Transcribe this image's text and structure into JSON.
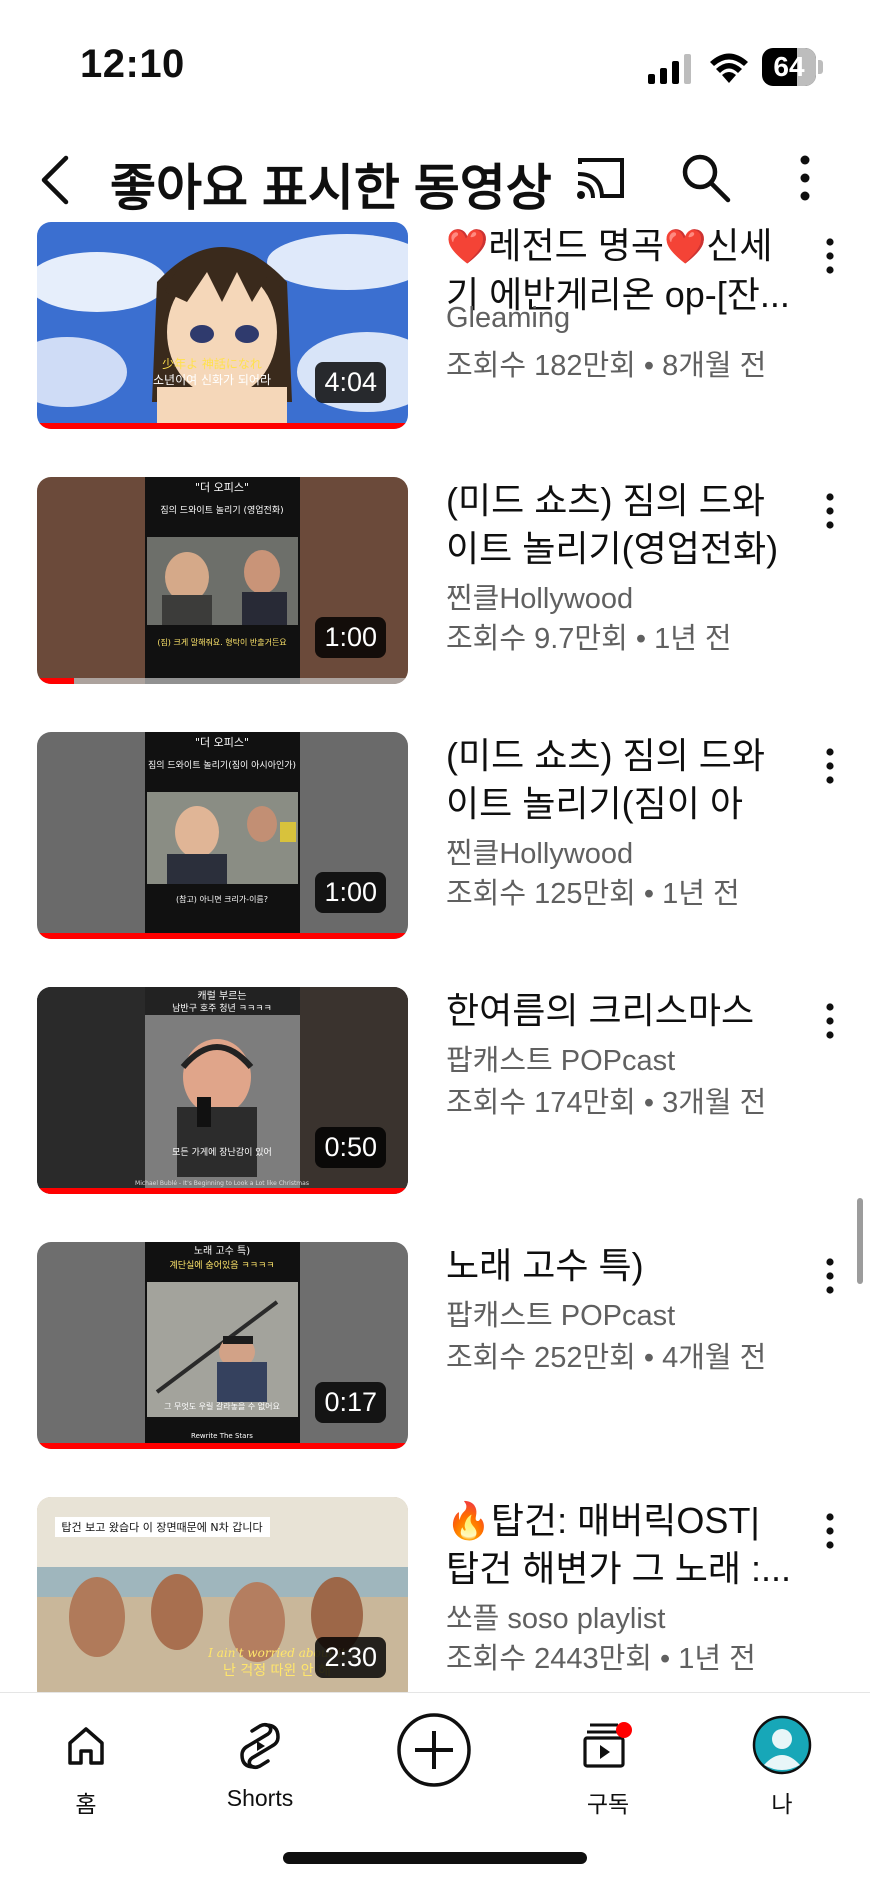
{
  "status_bar": {
    "time": "12:10",
    "battery": "64",
    "battery_level_pct": 64
  },
  "header": {
    "title": "좋아요 표시한 동영상",
    "icons": [
      "back-arrow-icon",
      "cast-icon",
      "search-icon",
      "more-vert-icon"
    ]
  },
  "videos": [
    {
      "title_prefix": "❤️",
      "title": "레전드 명곡",
      "title_mid": "❤️",
      "title_rest": "신세기 에반게리온 op-[잔...",
      "channel": "Gleaming",
      "views": "조회수 182만회",
      "age": "8개월 전",
      "duration": "4:04",
      "watched_fraction": 1.0,
      "thumb_caption": "소년이여 신화가 되어라",
      "thumb_caption_jp": "少年よ 神話になれ"
    },
    {
      "title": "(미드 쇼츠) 짐의 드와이트 놀리기(영업전화) (...",
      "channel": "찐클Hollywood",
      "views": "조회수 9.7만회",
      "age": "1년 전",
      "duration": "1:00",
      "watched_fraction": 0.1,
      "thumb_top": "\"더 오피스\"",
      "thumb_sub": "짐의 드와이트 놀리기 (영업전화)",
      "thumb_caption": "(짐) 크게 말해줘요. 형탁이 반출거든요"
    },
    {
      "title": "(미드 쇼츠) 짐의 드와이트 놀리기(짐이 아시...",
      "channel": "찐클Hollywood",
      "views": "조회수 125만회",
      "age": "1년 전",
      "duration": "1:00",
      "watched_fraction": 1.0,
      "thumb_top": "\"더 오피스\"",
      "thumb_sub": "짐의 드와이트 놀리기(짐이 아시아인가)",
      "thumb_caption": "(참고) 아니면 크리가-이름?"
    },
    {
      "title": "한여름의 크리스마스",
      "channel": "팝캐스트 POPcast",
      "views": "조회수 174만회",
      "age": "3개월 전",
      "duration": "0:50",
      "watched_fraction": 1.0,
      "thumb_top": "캐럴 부르는",
      "thumb_sub": "남반구 호주 청년 ㅋㅋㅋㅋ",
      "thumb_caption": "모든 가게에 장난감이 있어",
      "thumb_footer": "Michael Bublé - It's Beginning to Look a Lot like Christmas"
    },
    {
      "title": "노래 고수 특)",
      "channel": "팝캐스트 POPcast",
      "views": "조회수 252만회",
      "age": "4개월 전",
      "duration": "0:17",
      "watched_fraction": 1.0,
      "thumb_top": "노래 고수 특)",
      "thumb_sub": "계단실에 숨어있음 ㅋㅋㅋㅋ",
      "thumb_caption": "그 무엇도 우릴 갈라놓을 수 없어요",
      "thumb_footer": "Rewrite The Stars"
    },
    {
      "title_prefix": "🔥",
      "title": "탑건: 매버릭OST| 탑건 해변가 그 노래 :...",
      "channel": "쏘플 soso playlist",
      "views": "조회수 2443만회",
      "age": "1년 전",
      "duration": "2:30",
      "watched_fraction": 0.0,
      "thumb_top": "탑건 보고 왔습다 이 장면때문에 N차 갑니다",
      "thumb_caption": "난 걱정 따윈 안 해",
      "thumb_caption_en": "I ain't worried about it"
    }
  ],
  "separator": "•",
  "bottom_nav": [
    {
      "label": "홈",
      "icon": "home-icon"
    },
    {
      "label": "Shorts",
      "icon": "shorts-icon"
    },
    {
      "label": "",
      "icon": "create-plus-icon"
    },
    {
      "label": "구독",
      "icon": "subscriptions-icon"
    },
    {
      "label": "나",
      "icon": "avatar-icon"
    }
  ],
  "colors": {
    "accent_red": "#ff0000",
    "text_primary": "#0f0f0f",
    "text_secondary": "#606060",
    "avatar_teal": "#17a7b8"
  }
}
